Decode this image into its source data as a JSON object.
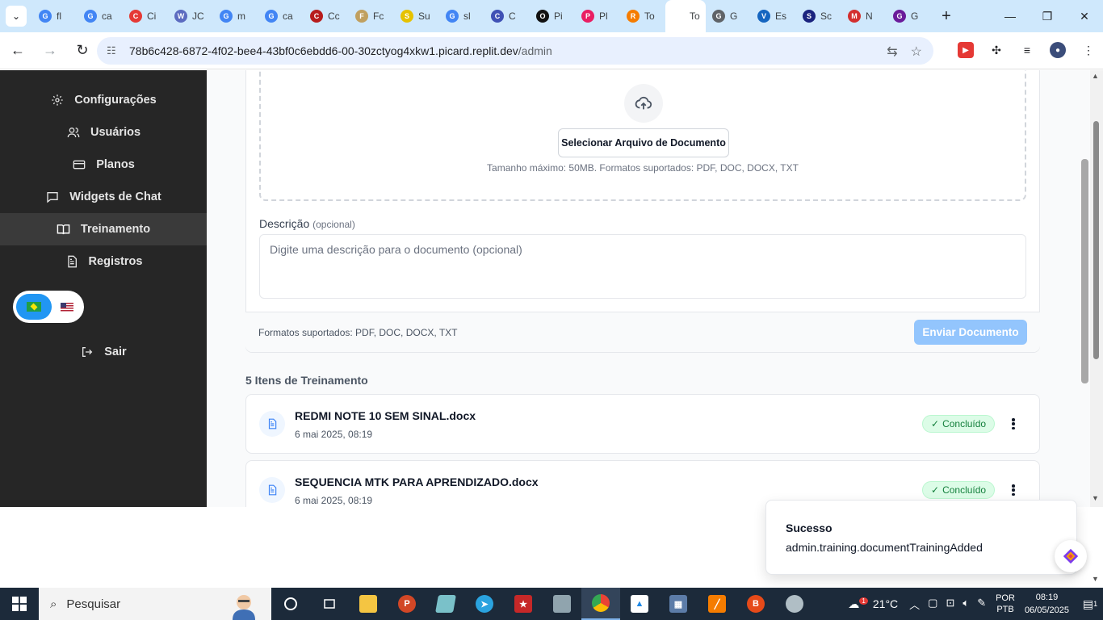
{
  "browser": {
    "tabs": [
      {
        "label": "fl",
        "color": "#4285f4",
        "glyph": "G"
      },
      {
        "label": "ca",
        "color": "#4285f4",
        "glyph": "G"
      },
      {
        "label": "Ci",
        "color": "#e53935",
        "glyph": "C"
      },
      {
        "label": "JC",
        "color": "#5c6bc0",
        "glyph": "W"
      },
      {
        "label": "m",
        "color": "#4285f4",
        "glyph": "G"
      },
      {
        "label": "ca",
        "color": "#4285f4",
        "glyph": "G"
      },
      {
        "label": "Cc",
        "color": "#b71c1c",
        "glyph": "C"
      },
      {
        "label": "Fc",
        "color": "#c0a060",
        "glyph": "F"
      },
      {
        "label": "Su",
        "color": "#e6c200",
        "glyph": "S"
      },
      {
        "label": "sl",
        "color": "#4285f4",
        "glyph": "G"
      },
      {
        "label": "C",
        "color": "#3f51b5",
        "glyph": "C"
      },
      {
        "label": "Pi",
        "color": "#111111",
        "glyph": "O"
      },
      {
        "label": "Pl",
        "color": "#e91e63",
        "glyph": "P"
      },
      {
        "label": "To",
        "color": "#f57c00",
        "glyph": "R"
      },
      {
        "label": "To",
        "color": "#ffffff",
        "glyph": ""
      },
      {
        "label": "G",
        "color": "#5f6368",
        "glyph": "G"
      },
      {
        "label": "Es",
        "color": "#1565c0",
        "glyph": "V"
      },
      {
        "label": "Sc",
        "color": "#1a237e",
        "glyph": "S"
      },
      {
        "label": "N",
        "color": "#d32f2f",
        "glyph": "M"
      },
      {
        "label": "G",
        "color": "#6a1b9a",
        "glyph": "G"
      }
    ],
    "active_close": "✕",
    "new_tab": "+",
    "url_host": "78b6c428-6872-4f02-bee4-43bf0c6ebdd6-00-30zctyog4xkw1.picard.replit.dev",
    "url_path": "/admin"
  },
  "sidebar": {
    "items": [
      {
        "label": "Configurações",
        "icon": "gear-icon"
      },
      {
        "label": "Usuários",
        "icon": "users-icon"
      },
      {
        "label": "Planos",
        "icon": "card-icon"
      },
      {
        "label": "Widgets de Chat",
        "icon": "chat-icon"
      },
      {
        "label": "Treinamento",
        "icon": "book-icon"
      },
      {
        "label": "Registros",
        "icon": "file-icon"
      }
    ],
    "logout": "Sair"
  },
  "upload": {
    "select_button": "Selecionar Arquivo de Documento",
    "hint": "Tamanho máximo: 50MB. Formatos suportados: PDF, DOC, DOCX, TXT"
  },
  "description": {
    "label": "Descrição",
    "optional": "(opcional)",
    "placeholder": "Digite uma descrição para o documento (opcional)"
  },
  "footer": {
    "formats": "Formatos suportados: PDF, DOC, DOCX, TXT",
    "send_button": "Enviar Documento"
  },
  "training": {
    "title": "5 Itens de Treinamento",
    "items": [
      {
        "name": "REDMI NOTE 10 SEM SINAL.docx",
        "date": "6 mai 2025, 08:19",
        "status": "Concluído"
      },
      {
        "name": "SEQUENCIA MTK PARA APRENDIZADO.docx",
        "date": "6 mai 2025, 08:19",
        "status": "Concluído"
      }
    ]
  },
  "toast": {
    "title": "Sucesso",
    "message": "admin.training.documentTrainingAdded"
  },
  "taskbar": {
    "search": "Pesquisar",
    "temperature": "21°C",
    "weather_badge": "1",
    "lang_line1": "POR",
    "lang_line2": "PTB",
    "time": "08:19",
    "date": "06/05/2025",
    "notification_count": "1"
  },
  "colors": {
    "sidebar_bg": "#262626",
    "accent_blue": "#93c5fd",
    "success_green": "#15803d"
  }
}
